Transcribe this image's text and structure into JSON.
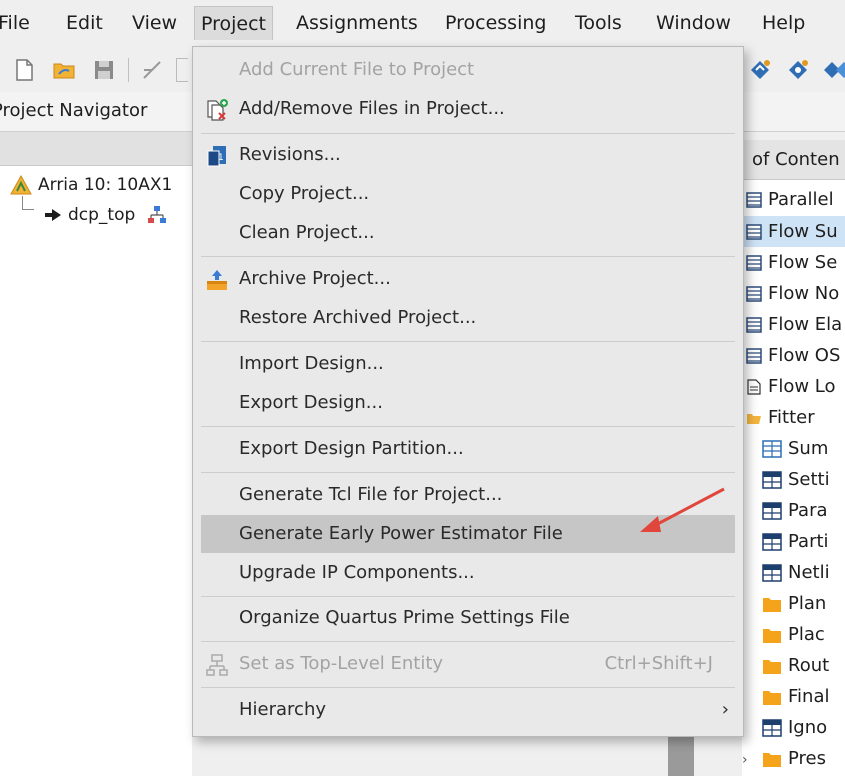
{
  "menubar": {
    "items": [
      "File",
      "Edit",
      "View",
      "Project",
      "Assignments",
      "Processing",
      "Tools",
      "Window",
      "Help"
    ]
  },
  "navigator": {
    "title": "Project Navigator",
    "device": "Arria 10: 10AX1",
    "top_entity": "dcp_top"
  },
  "report_panel": {
    "header": "of Conten",
    "rows": [
      "Parallel",
      "Flow Su",
      "Flow Se",
      "Flow No",
      "Flow Ela",
      "Flow OS",
      "Flow Lo",
      "Fitter",
      "Sum",
      "Setti",
      "Para",
      "Parti",
      "Netli",
      "Plan",
      "Plac",
      "Rout",
      "Final",
      "Igno",
      "Pres"
    ]
  },
  "project_menu": {
    "items": [
      {
        "label": "Add Current File to Project",
        "disabled": true
      },
      {
        "label": "Add/Remove Files in Project..."
      },
      {
        "label": "Revisions..."
      },
      {
        "label": "Copy Project..."
      },
      {
        "label": "Clean Project..."
      },
      {
        "label": "Archive Project..."
      },
      {
        "label": "Restore Archived Project..."
      },
      {
        "label": "Import Design..."
      },
      {
        "label": "Export Design..."
      },
      {
        "label": "Export Design Partition..."
      },
      {
        "label": "Generate Tcl File for Project..."
      },
      {
        "label": "Generate Early Power Estimator File",
        "highlighted": true
      },
      {
        "label": "Upgrade IP Components..."
      },
      {
        "label": "Organize Quartus Prime Settings File"
      },
      {
        "label": "Set as Top-Level Entity",
        "disabled": true,
        "shortcut": "Ctrl+Shift+J"
      },
      {
        "label": "Hierarchy",
        "submenu": true
      }
    ]
  },
  "colors": {
    "menu_bg": "#e9e9e9",
    "highlight": "#c6c6c6",
    "disabled_text": "#a3a3a3",
    "annotation_arrow": "#e0463c",
    "selected_row": "#cfe3f7"
  }
}
